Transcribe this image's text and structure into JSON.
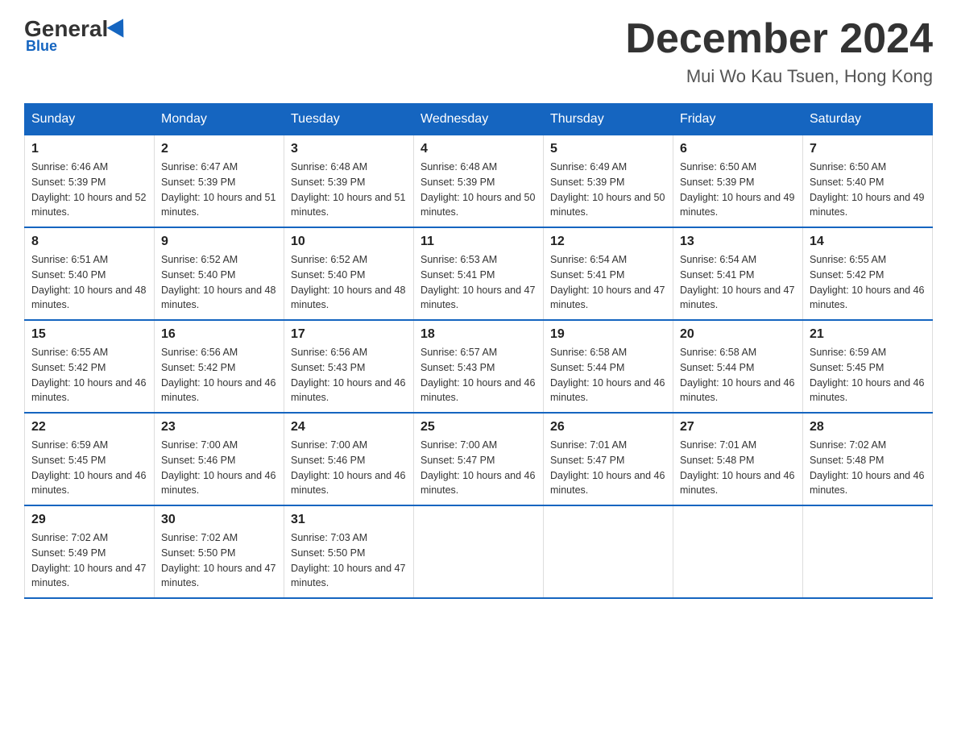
{
  "header": {
    "logo_general": "General",
    "logo_blue": "Blue",
    "month_title": "December 2024",
    "location": "Mui Wo Kau Tsuen, Hong Kong"
  },
  "weekdays": [
    "Sunday",
    "Monday",
    "Tuesday",
    "Wednesday",
    "Thursday",
    "Friday",
    "Saturday"
  ],
  "weeks": [
    [
      {
        "day": "1",
        "sunrise": "6:46 AM",
        "sunset": "5:39 PM",
        "daylight": "10 hours and 52 minutes."
      },
      {
        "day": "2",
        "sunrise": "6:47 AM",
        "sunset": "5:39 PM",
        "daylight": "10 hours and 51 minutes."
      },
      {
        "day": "3",
        "sunrise": "6:48 AM",
        "sunset": "5:39 PM",
        "daylight": "10 hours and 51 minutes."
      },
      {
        "day": "4",
        "sunrise": "6:48 AM",
        "sunset": "5:39 PM",
        "daylight": "10 hours and 50 minutes."
      },
      {
        "day": "5",
        "sunrise": "6:49 AM",
        "sunset": "5:39 PM",
        "daylight": "10 hours and 50 minutes."
      },
      {
        "day": "6",
        "sunrise": "6:50 AM",
        "sunset": "5:39 PM",
        "daylight": "10 hours and 49 minutes."
      },
      {
        "day": "7",
        "sunrise": "6:50 AM",
        "sunset": "5:40 PM",
        "daylight": "10 hours and 49 minutes."
      }
    ],
    [
      {
        "day": "8",
        "sunrise": "6:51 AM",
        "sunset": "5:40 PM",
        "daylight": "10 hours and 48 minutes."
      },
      {
        "day": "9",
        "sunrise": "6:52 AM",
        "sunset": "5:40 PM",
        "daylight": "10 hours and 48 minutes."
      },
      {
        "day": "10",
        "sunrise": "6:52 AM",
        "sunset": "5:40 PM",
        "daylight": "10 hours and 48 minutes."
      },
      {
        "day": "11",
        "sunrise": "6:53 AM",
        "sunset": "5:41 PM",
        "daylight": "10 hours and 47 minutes."
      },
      {
        "day": "12",
        "sunrise": "6:54 AM",
        "sunset": "5:41 PM",
        "daylight": "10 hours and 47 minutes."
      },
      {
        "day": "13",
        "sunrise": "6:54 AM",
        "sunset": "5:41 PM",
        "daylight": "10 hours and 47 minutes."
      },
      {
        "day": "14",
        "sunrise": "6:55 AM",
        "sunset": "5:42 PM",
        "daylight": "10 hours and 46 minutes."
      }
    ],
    [
      {
        "day": "15",
        "sunrise": "6:55 AM",
        "sunset": "5:42 PM",
        "daylight": "10 hours and 46 minutes."
      },
      {
        "day": "16",
        "sunrise": "6:56 AM",
        "sunset": "5:42 PM",
        "daylight": "10 hours and 46 minutes."
      },
      {
        "day": "17",
        "sunrise": "6:56 AM",
        "sunset": "5:43 PM",
        "daylight": "10 hours and 46 minutes."
      },
      {
        "day": "18",
        "sunrise": "6:57 AM",
        "sunset": "5:43 PM",
        "daylight": "10 hours and 46 minutes."
      },
      {
        "day": "19",
        "sunrise": "6:58 AM",
        "sunset": "5:44 PM",
        "daylight": "10 hours and 46 minutes."
      },
      {
        "day": "20",
        "sunrise": "6:58 AM",
        "sunset": "5:44 PM",
        "daylight": "10 hours and 46 minutes."
      },
      {
        "day": "21",
        "sunrise": "6:59 AM",
        "sunset": "5:45 PM",
        "daylight": "10 hours and 46 minutes."
      }
    ],
    [
      {
        "day": "22",
        "sunrise": "6:59 AM",
        "sunset": "5:45 PM",
        "daylight": "10 hours and 46 minutes."
      },
      {
        "day": "23",
        "sunrise": "7:00 AM",
        "sunset": "5:46 PM",
        "daylight": "10 hours and 46 minutes."
      },
      {
        "day": "24",
        "sunrise": "7:00 AM",
        "sunset": "5:46 PM",
        "daylight": "10 hours and 46 minutes."
      },
      {
        "day": "25",
        "sunrise": "7:00 AM",
        "sunset": "5:47 PM",
        "daylight": "10 hours and 46 minutes."
      },
      {
        "day": "26",
        "sunrise": "7:01 AM",
        "sunset": "5:47 PM",
        "daylight": "10 hours and 46 minutes."
      },
      {
        "day": "27",
        "sunrise": "7:01 AM",
        "sunset": "5:48 PM",
        "daylight": "10 hours and 46 minutes."
      },
      {
        "day": "28",
        "sunrise": "7:02 AM",
        "sunset": "5:48 PM",
        "daylight": "10 hours and 46 minutes."
      }
    ],
    [
      {
        "day": "29",
        "sunrise": "7:02 AM",
        "sunset": "5:49 PM",
        "daylight": "10 hours and 47 minutes."
      },
      {
        "day": "30",
        "sunrise": "7:02 AM",
        "sunset": "5:50 PM",
        "daylight": "10 hours and 47 minutes."
      },
      {
        "day": "31",
        "sunrise": "7:03 AM",
        "sunset": "5:50 PM",
        "daylight": "10 hours and 47 minutes."
      },
      null,
      null,
      null,
      null
    ]
  ]
}
